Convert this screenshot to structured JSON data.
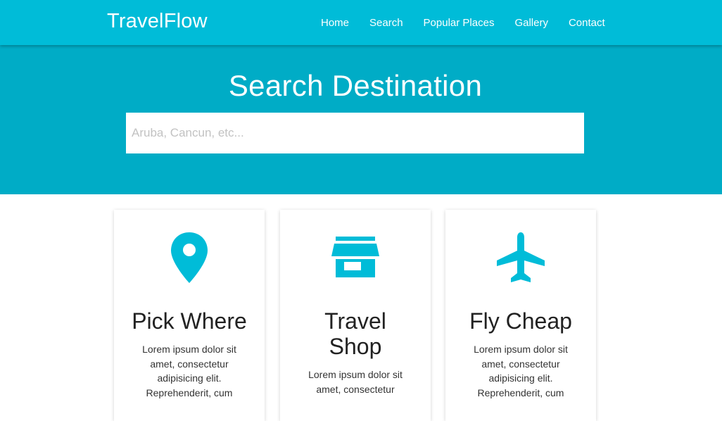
{
  "navbar": {
    "brand": "TravelFlow",
    "links": [
      "Home",
      "Search",
      "Popular Places",
      "Gallery",
      "Contact"
    ]
  },
  "hero": {
    "title": "Search Destination",
    "search_placeholder": "Aruba, Cancun, etc..."
  },
  "cards": [
    {
      "icon": "map-pin-icon",
      "title": "Pick Where",
      "text": "Lorem ipsum dolor sit amet, consectetur adipisicing elit. Reprehenderit, cum"
    },
    {
      "icon": "store-icon",
      "title": "Travel Shop",
      "text": "Lorem ipsum dolor sit amet, consectetur"
    },
    {
      "icon": "airplane-icon",
      "title": "Fly Cheap",
      "text": "Lorem ipsum dolor sit amet, consectetur adipisicing elit. Reprehenderit, cum"
    }
  ],
  "colors": {
    "navbar": "#00bcd8",
    "hero": "#00acc6",
    "icon": "#00bcd8"
  }
}
